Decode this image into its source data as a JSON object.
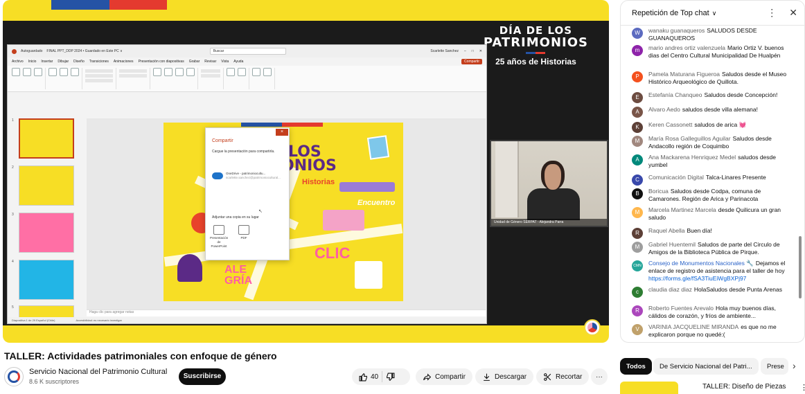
{
  "player": {
    "logo_line1": "DÍA DE LOS",
    "logo_line2": "PATRIMONIOS",
    "logo_line3": "25 años de Historias",
    "ppt": {
      "file_title": "FINAL PPT_DDP 2024 • Guardado en Este PC ∨",
      "search_placeholder": "Buscar",
      "user_name": "Scarlette Sanchez",
      "menu": [
        "Archivo",
        "Inicio",
        "Insertar",
        "Dibujar",
        "Diseño",
        "Transiciones",
        "Animaciones",
        "Presentación con diapositivas",
        "Grabar",
        "Revisar",
        "Vista",
        "Ayuda"
      ],
      "share_label": "Compartir",
      "notes_placeholder": "Haga clic para agregar notas",
      "status_left": "Diapositiva 1 de 29   Español (Chile)",
      "status_access": "Accesibilidad: es necesario investigar",
      "slide_title_1": "LOS",
      "slide_title_2": "ONIOS",
      "slide_title_3": "Historias",
      "slide_encuentro": "Encuentro",
      "slide_ale_1": "ALE",
      "slide_ale_2": "GRÍA",
      "slide_clic": "CLIC",
      "dialog": {
        "title": "Compartir",
        "text": "Cargue la presentación para compartirla.",
        "onedrive_name": "OneDrive - patrimoniocultu...",
        "onedrive_email": "scarlette.sanchez@patrimoniocultural...",
        "attach_label": "Adjuntar una copia en su lugar",
        "opt_ppt": "Presentación de PowerPoint",
        "opt_pdf": "PDF",
        "close_label": "×"
      }
    },
    "webcam_label": "Unidad de Género SERPAT - Alejandra Parra"
  },
  "video": {
    "title": "TALLER: Actividades patrimoniales con enfoque de género",
    "channel_name": "Servicio Nacional del Patrimonio Cultural",
    "subscribers": "8.6 K suscriptores",
    "subscribe_label": "Suscribirse",
    "like_count": "40",
    "share_label": "Compartir",
    "download_label": "Descargar",
    "clip_label": "Recortar",
    "more_label": "···"
  },
  "chat": {
    "header": "Repetición de Top chat",
    "messages": [
      {
        "initial": "W",
        "color": "#5c6bc0",
        "author": "wanaku guanaqueros",
        "text": "SALUDOS DESDE GUANAQUEROS"
      },
      {
        "initial": "m",
        "color": "#8e24aa",
        "author": "mario andres ortiz valenzuela",
        "text": "Mario Ortiz V. buenos dias del Centro Cultural Municipalidad De Hualpén"
      },
      {
        "initial": "P",
        "color": "#f4511e",
        "author": "Pamela Maturana Figueroa",
        "text": "Saludos desde el Museo Histórico Arqueológico de Quillota."
      },
      {
        "initial": "E",
        "color": "#6d4c41",
        "author": "Estefanía Chanqueo",
        "text": "Saludos desde Concepción!"
      },
      {
        "initial": "A",
        "color": "#795548",
        "author": "Alvaro Aedo",
        "text": "saludos desde villa alemana!"
      },
      {
        "initial": "K",
        "color": "#5d4037",
        "author": "Keren Cassonett",
        "text": "saludos de arica 💓"
      },
      {
        "initial": "M",
        "color": "#a1887f",
        "author": "María Rosa Galleguillos Aguilar",
        "text": "Saludos desde Andacollo región de Coquimbo"
      },
      {
        "initial": "A",
        "color": "#00897b",
        "author": "Ana Mackarena Henriquez Medel",
        "text": "saludos desde yumbel"
      },
      {
        "initial": "C",
        "color": "#3949ab",
        "author": "Comunicación Digital",
        "text": "Talca-Linares Presente"
      },
      {
        "initial": "B",
        "color": "#111111",
        "author": "Boricua",
        "text": "Saludos desde Codpa, comuna de Camarones. Región de Arica y Parinacota"
      },
      {
        "initial": "M",
        "color": "#ffb74d",
        "author": "Marcela Martinez Marcela",
        "text": "desde Quilicura un gran saludo"
      },
      {
        "initial": "R",
        "color": "#5d4037",
        "author": "Raquel Abella",
        "text": "Buen día!"
      },
      {
        "initial": "M",
        "color": "#9e9e9e",
        "author": "Gabriel Huentemil",
        "text": "Saludos de parte del Circulo de Amigos de la Biblioteca Pública de Pirque."
      },
      {
        "initial": "CMN",
        "color": "#26a69a",
        "author": "Consejo de Monumentos Nacionales 🔧",
        "text": "Dejamos el enlace de registro de asistencia para el taller de hoy",
        "link": "https://forms.gle/fSA3TiuEiWgBXPj97"
      },
      {
        "initial": "c",
        "color": "#2e7d32",
        "author": "claudia diaz diaz",
        "text": "HolaSaludos desde Punta Arenas"
      },
      {
        "initial": "R",
        "color": "#ab47bc",
        "author": "Roberto Fuentes Arevalo",
        "text": "Hola muy buenos días, cálidos de corazón, y fríos de ambiente..."
      },
      {
        "initial": "V",
        "color": "#c0a16b",
        "author": "VARINIA JACQUELINE MIRANDA",
        "text": "es que no me explicaron porque no quedé:("
      }
    ]
  },
  "related": {
    "chips": [
      "Todos",
      "De Servicio Nacional del Patri...",
      "Prese"
    ],
    "first_title": "TALLER: Diseño de Piezas"
  },
  "colors": {
    "accent_yellow": "#f7de25",
    "flag_blue": "#2553a5",
    "flag_red": "#e43a2f",
    "ppt_red": "#c43e1c"
  }
}
